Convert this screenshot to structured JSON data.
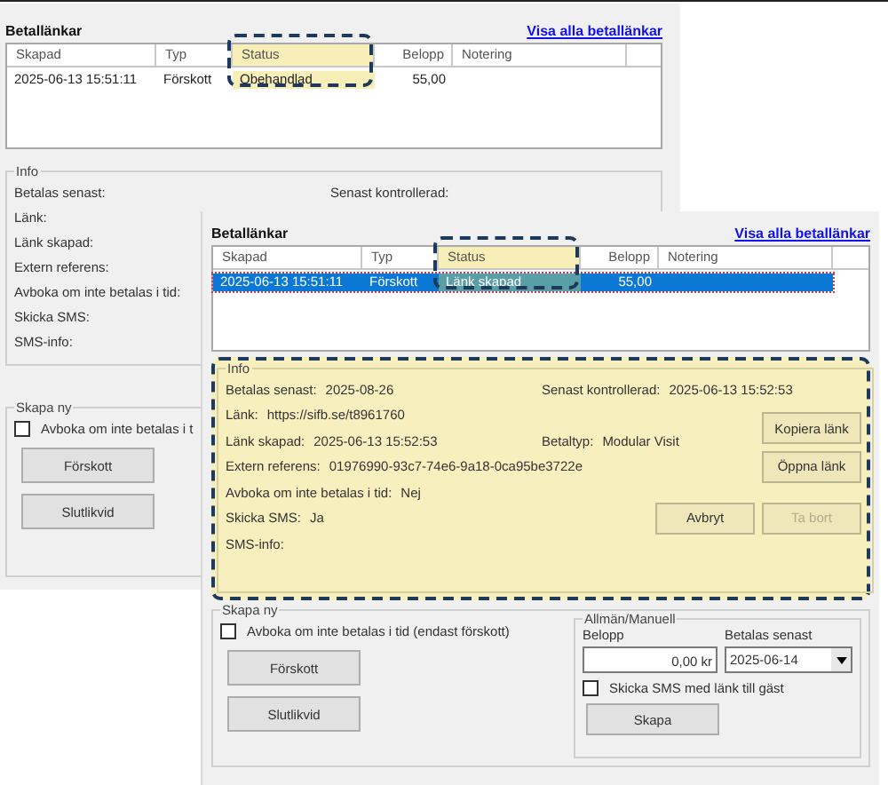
{
  "windows": [
    {
      "kind": "back",
      "section_title": "Betallänkar",
      "link": "Visa alla betallänkar",
      "table": {
        "columns": [
          {
            "label": "Skapad",
            "highlighted": false
          },
          {
            "label": "Typ",
            "highlighted": false
          },
          {
            "label": "Status",
            "highlighted": true
          },
          {
            "label": "Belopp",
            "highlighted": false
          },
          {
            "label": "Notering",
            "highlighted": false
          }
        ],
        "rows": [
          {
            "selected": false,
            "cells": [
              "2025-06-13 15:51:11",
              "Förskott",
              "Obehandlad",
              "55,00"
            ]
          }
        ]
      },
      "info": {
        "legend": "Info",
        "highlighted": false,
        "rows": [
          {
            "left": {
              "label": "Betalas senast:"
            },
            "right": {
              "label": "Senast kontrollerad:"
            }
          },
          {
            "left": {
              "label": "Länk:"
            }
          },
          {
            "left": {
              "label": "Länk skapad:"
            }
          },
          {
            "left": {
              "label": "Extern referens:"
            }
          },
          {
            "left": {
              "label": "Avboka om inte betalas i tid:"
            }
          },
          {
            "left": {
              "label": "Skicka SMS:"
            }
          },
          {
            "left": {
              "label": "SMS-info:"
            }
          }
        ]
      },
      "create": {
        "legend": "Skapa ny",
        "checkbox": {
          "label": "Avboka om inte betalas i t",
          "checked": false
        },
        "buttons": [
          "Förskott",
          "Slutlikvid"
        ]
      }
    },
    {
      "kind": "front",
      "section_title": "Betallänkar",
      "link": "Visa alla betallänkar",
      "table": {
        "columns": [
          {
            "label": "Skapad",
            "highlighted": false
          },
          {
            "label": "Typ",
            "highlighted": false
          },
          {
            "label": "Status",
            "highlighted": true
          },
          {
            "label": "Belopp",
            "highlighted": false
          },
          {
            "label": "Notering",
            "highlighted": false
          }
        ],
        "rows": [
          {
            "selected": true,
            "cells": [
              "2025-06-13 15:51:11",
              "Förskott",
              "Länk skapad",
              "55,00"
            ]
          }
        ]
      },
      "info": {
        "legend": "Info",
        "highlighted": true,
        "rows": [
          {
            "left": {
              "label": "Betalas senast:",
              "value": "2025-08-26"
            },
            "right": {
              "label": "Senast kontrollerad:",
              "value": "2025-06-13 15:52:53"
            }
          },
          {
            "left": {
              "label": "Länk:",
              "value": "https://sifb.se/t8961760"
            }
          },
          {
            "left": {
              "label": "Länk skapad:",
              "value": "2025-06-13 15:52:53"
            },
            "right": {
              "label": "Betaltyp:",
              "value": "Modular Visit"
            }
          },
          {
            "left": {
              "label": "Extern referens:",
              "value": "01976990-93c7-74e6-9a18-0ca95be3722e"
            }
          },
          {
            "left": {
              "label": "Avboka om inte betalas i tid:",
              "value": "Nej"
            }
          },
          {
            "left": {
              "label": "Skicka SMS:",
              "value": "Ja"
            }
          },
          {
            "left": {
              "label": "SMS-info:"
            }
          }
        ],
        "buttons": [
          {
            "label": "Kopiera länk",
            "disabled": false
          },
          {
            "label": "Öppna länk",
            "disabled": false
          },
          {
            "label": "Avbryt",
            "disabled": false
          },
          {
            "label": "Ta bort",
            "disabled": true
          }
        ]
      },
      "create": {
        "legend": "Skapa ny",
        "checkbox": {
          "label": "Avboka om inte betalas i tid (endast förskott)",
          "checked": false
        },
        "buttons": [
          "Förskott",
          "Slutlikvid"
        ],
        "manual": {
          "legend": "Allmän/Manuell",
          "amount_label": "Belopp",
          "amount_value": "0,00 kr",
          "date_label": "Betalas senast",
          "date_value": "2025-06-14",
          "sms_checkbox": {
            "label": "Skicka SMS med länk till gäst",
            "checked": false
          },
          "button": "Skapa"
        }
      }
    }
  ]
}
